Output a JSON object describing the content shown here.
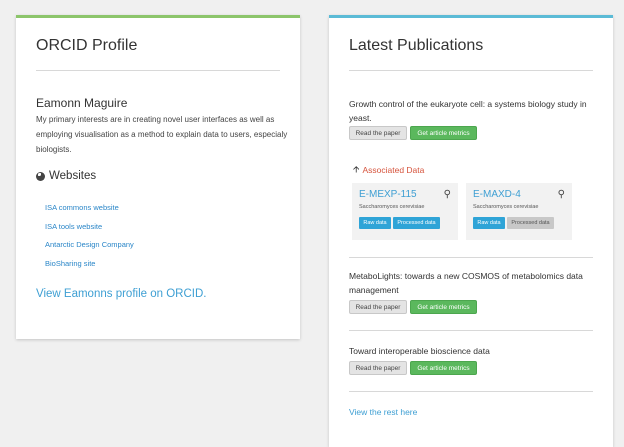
{
  "profile": {
    "title": "ORCID Profile",
    "name": "Eamonn Maguire",
    "bio": "My primary interests are in creating novel user interfaces as well as employing visualisation as a method to explain data to users, especialy biologists.",
    "websites_heading": "Websites",
    "websites": [
      "ISA commons website",
      "ISA tools website",
      "Antarctic Design Company",
      "BioSharing site"
    ],
    "orcid_link": "View Eamonns profile on ORCID."
  },
  "publications": {
    "title": "Latest Publications",
    "read_label": "Read the paper",
    "metrics_label": "Get article metrics",
    "items": [
      {
        "title": "Growth control of the eukaryote cell: a systems biology study in yeast."
      },
      {
        "title": "MetaboLights: towards a new COSMOS of metabolomics data management"
      },
      {
        "title": "Toward interoperable bioscience data"
      }
    ],
    "associated_label": "Associated Data",
    "datasets": [
      {
        "name": "E-MEXP-115",
        "species": "Saccharomyces cerevisiae",
        "raw": "Raw data",
        "processed": "Processed data",
        "processed_enabled": true
      },
      {
        "name": "E-MAXD-4",
        "species": "Saccharomyces cerevisiae",
        "raw": "Raw data",
        "processed": "Processed data",
        "processed_enabled": false
      }
    ],
    "rest_link": "View the rest here"
  },
  "colors": {
    "left_accent": "#8cc56b",
    "right_accent": "#5bbbd6",
    "link": "#2a86c8",
    "metrics_green": "#5bb85d",
    "associated_red": "#d6533c"
  },
  "icons": {
    "websites": "globe-icon",
    "associated": "arrow-up-icon",
    "dataset_tool": "microscope-icon"
  }
}
